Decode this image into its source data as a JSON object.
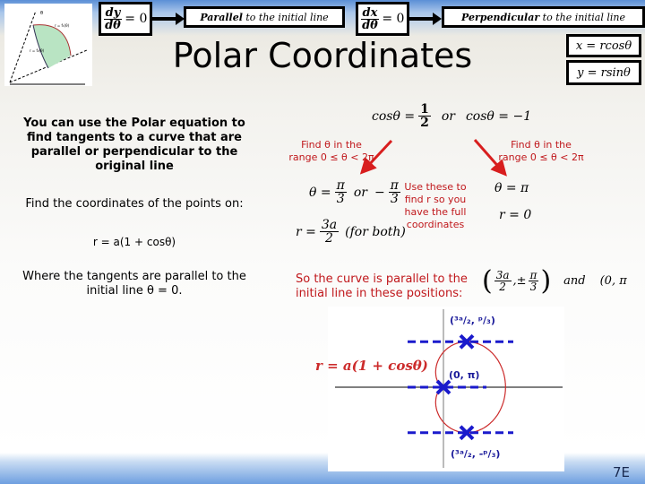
{
  "slide": {
    "title": "Polar Coordinates",
    "slide_number": "7E"
  },
  "header": {
    "dy_box": {
      "numerator": "dy",
      "denominator": "dθ",
      "rhs": "= 0"
    },
    "parallel_box": {
      "bold": "Parallel",
      "rest": " to the initial line"
    },
    "dx_box": {
      "numerator": "dx",
      "denominator": "dθ",
      "rhs": "= 0"
    },
    "perpendicular_box": {
      "bold": "Perpendicular",
      "rest": " to the initial line"
    }
  },
  "conversion": {
    "x_formula": "x = rcosθ",
    "y_formula": "y = rsinθ"
  },
  "thumbnail": {
    "label_top": "θ",
    "label_curve1": "r = f₁(θ)",
    "label_curve2": "r = f₂(θ)",
    "fill_color": "#b9e4c3"
  },
  "left": {
    "intro": "You can use the Polar equation to find tangents to a curve that are parallel or perpendicular to the original line",
    "find_text": "Find the coordinates of the points on:",
    "equation": "r = a(1 + cosθ)",
    "where_text": "Where the tangents are parallel to the initial line θ = 0."
  },
  "solution": {
    "cos_lhs": "cosθ =",
    "cos_num": "1",
    "cos_den": "2",
    "or1": "or",
    "cos_rhs": "cosθ = −1",
    "find_theta_left": "Find θ in the range 0 ≤ θ < 2π",
    "find_theta_right": "Find θ in the range 0 ≤ θ < 2π",
    "theta_lhs": "θ =",
    "theta_frac_num": "π",
    "theta_frac_den": "3",
    "or2": "or",
    "theta_neg": "−",
    "r_lhs": "r =",
    "r_num": "3a",
    "r_den": "2",
    "r_note": "(for both)",
    "use_these": "Use these to find r so you have the full coordinates",
    "theta_pi": "θ = π",
    "r_zero": "r = 0",
    "conclusion": "So the curve is parallel to the initial line in these positions:",
    "coord_num1": "3a",
    "coord_den1": "2",
    "coord_pm": ",±",
    "coord_num2": "π",
    "coord_den2": "3",
    "and": "and",
    "coord2": "(0, π"
  },
  "graph": {
    "equation_label": "r = a(1 + cosθ)",
    "point_top": "(³ᵃ/₂, ᵖ/₃)",
    "point_origin": "(0, π)",
    "point_bottom": "(³ᵃ/₂, -ᵖ/₃)",
    "curve_color": "#cc2b2b",
    "marker_color": "#1a1acc",
    "label_color": "#1a1a9a"
  },
  "colors": {
    "annotation_red": "#c0171b"
  }
}
